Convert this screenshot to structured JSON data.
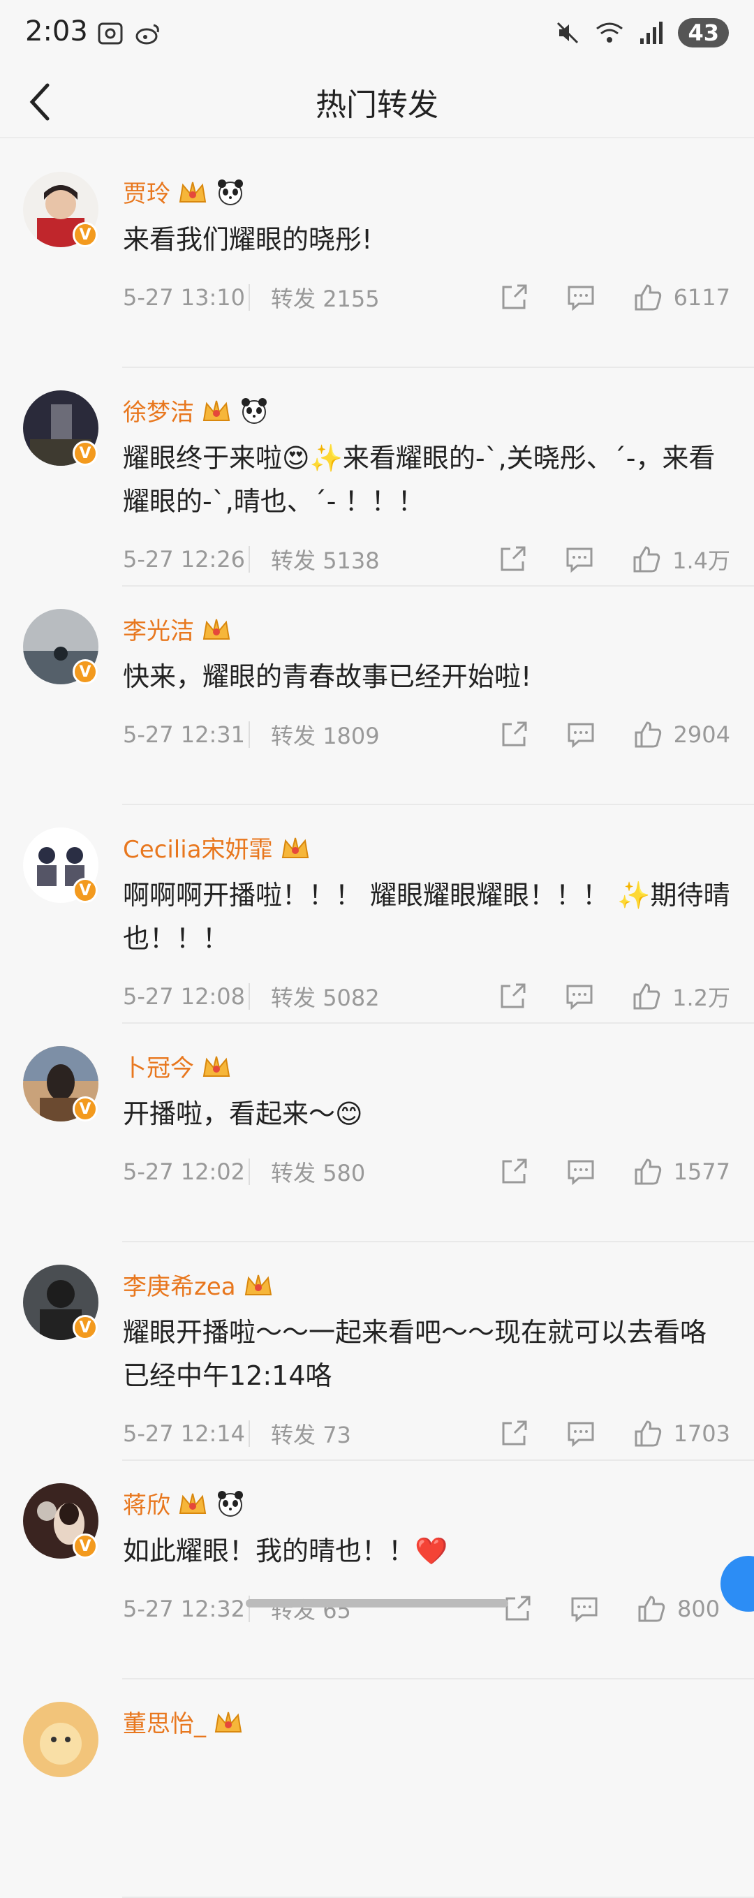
{
  "status": {
    "time": "2:03",
    "battery": "43"
  },
  "header": {
    "title": "热门转发"
  },
  "labels": {
    "repost": "转发"
  },
  "posts": [
    {
      "name": "贾玲",
      "content": "来看我们耀眼的晓彤!",
      "time": "5-27 13:10",
      "reposts": "2155",
      "likes": "6117"
    },
    {
      "name": "徐梦洁",
      "content": "耀眼终于来啦😍✨来看耀眼的-`,关晓彤、´-，来看耀眼的-`,晴也、´- ！！！",
      "time": "5-27 12:26",
      "reposts": "5138",
      "likes": "1.4万"
    },
    {
      "name": "李光洁",
      "content": "快来，耀眼的青春故事已经开始啦!",
      "time": "5-27 12:31",
      "reposts": "1809",
      "likes": "2904"
    },
    {
      "name": "Cecilia宋妍霏",
      "content": "啊啊啊开播啦！！！ 耀眼耀眼耀眼！！！ ✨期待晴也！！！",
      "time": "5-27 12:08",
      "reposts": "5082",
      "likes": "1.2万"
    },
    {
      "name": "卜冠今",
      "content": "开播啦，看起来～😊",
      "time": "5-27 12:02",
      "reposts": "580",
      "likes": "1577"
    },
    {
      "name": "李庚希zea",
      "content": "耀眼开播啦～～一起来看吧～～现在就可以去看咯 已经中午12:14咯",
      "time": "5-27 12:14",
      "reposts": "73",
      "likes": "1703"
    },
    {
      "name": "蒋欣",
      "content": "如此耀眼！我的晴也！！❤️",
      "time": "5-27 12:32",
      "reposts": "65",
      "likes": "800"
    },
    {
      "name": "董思怡_",
      "content": "",
      "time": "",
      "reposts": "",
      "likes": ""
    }
  ]
}
